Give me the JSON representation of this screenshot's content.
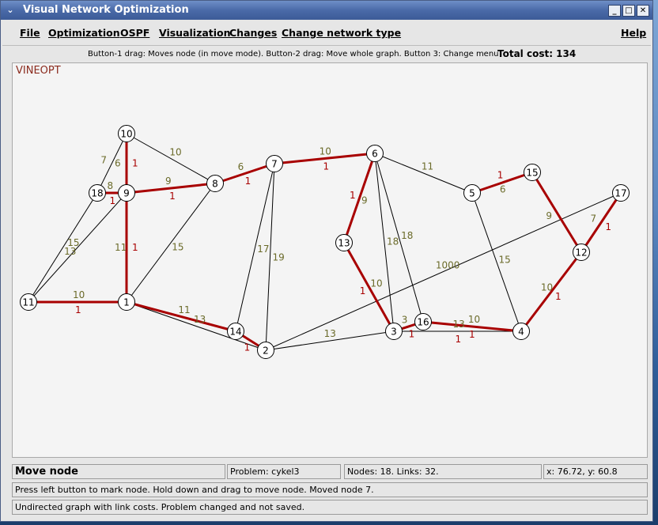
{
  "window": {
    "title": "Visual Network Optimization",
    "buttons": [
      "_",
      "□",
      "✕"
    ]
  },
  "menubar": {
    "items": [
      {
        "label": "File"
      },
      {
        "label": "Optimization"
      },
      {
        "label": "OSPF"
      },
      {
        "label": "Visualization"
      },
      {
        "label": "Changes"
      },
      {
        "label": "Change network type"
      }
    ],
    "help": "Help"
  },
  "infobar": {
    "hint": "Button-1 drag: Moves node (in move mode). Button-2 drag: Move whole graph. Button 3: Change menu",
    "total_cost": "Total cost: 134"
  },
  "canvas": {
    "app_label": "VINEOPT",
    "colors": {
      "thick_edge": "#a80000",
      "cost_text": "#6b6b2a",
      "flow_text": "#a80000"
    },
    "nodes": [
      {
        "id": "1"
      },
      {
        "id": "2"
      },
      {
        "id": "3"
      },
      {
        "id": "4"
      },
      {
        "id": "5"
      },
      {
        "id": "6"
      },
      {
        "id": "7"
      },
      {
        "id": "8"
      },
      {
        "id": "9"
      },
      {
        "id": "10"
      },
      {
        "id": "11"
      },
      {
        "id": "12"
      },
      {
        "id": "13"
      },
      {
        "id": "14"
      },
      {
        "id": "15"
      },
      {
        "id": "16"
      },
      {
        "id": "17"
      },
      {
        "id": "18"
      }
    ],
    "edges": [
      {
        "a": "11",
        "b": "1",
        "cost": "10",
        "flow": "1",
        "thick": true
      },
      {
        "a": "1",
        "b": "9",
        "cost": "11",
        "flow": "1",
        "thick": true
      },
      {
        "a": "9",
        "b": "10",
        "cost": "6",
        "flow": "1",
        "thick": true
      },
      {
        "a": "9",
        "b": "8",
        "cost": "9",
        "flow": "1",
        "thick": true
      },
      {
        "a": "8",
        "b": "7",
        "cost": "6",
        "flow": "1",
        "thick": true
      },
      {
        "a": "7",
        "b": "6",
        "cost": "10",
        "flow": "1",
        "thick": true
      },
      {
        "a": "6",
        "b": "13",
        "cost": "9",
        "flow": "1",
        "thick": true
      },
      {
        "a": "13",
        "b": "3",
        "cost": "10",
        "flow": "1",
        "thick": true
      },
      {
        "a": "3",
        "b": "16",
        "cost": "3",
        "flow": "1",
        "thick": true
      },
      {
        "a": "16",
        "b": "4",
        "cost": "10",
        "flow": "1",
        "thick": true
      },
      {
        "a": "4",
        "b": "12",
        "cost": "10",
        "flow": "1",
        "thick": true
      },
      {
        "a": "12",
        "b": "15",
        "cost": "9",
        "flow": "",
        "thick": true
      },
      {
        "a": "15",
        "b": "5",
        "cost": "6",
        "flow": "1",
        "thick": true
      },
      {
        "a": "12",
        "b": "17",
        "cost": "7",
        "flow": "1",
        "thick": true
      },
      {
        "a": "1",
        "b": "14",
        "cost": "11",
        "flow": "",
        "thick": true
      },
      {
        "a": "14",
        "b": "2",
        "cost": "",
        "flow": "1",
        "thick": true
      },
      {
        "a": "18",
        "b": "9",
        "cost": "8",
        "flow": "1",
        "thick": true
      },
      {
        "a": "10",
        "b": "8",
        "cost": "10",
        "flow": "",
        "thick": false
      },
      {
        "a": "18",
        "b": "10",
        "cost": "7",
        "flow": "",
        "thick": false
      },
      {
        "a": "18",
        "b": "11",
        "cost": "13",
        "flow": "",
        "thick": false
      },
      {
        "a": "11",
        "b": "9",
        "cost": "15",
        "flow": "",
        "thick": false
      },
      {
        "a": "8",
        "b": "1",
        "cost": "15",
        "flow": "",
        "thick": false
      },
      {
        "a": "7",
        "b": "14",
        "cost": "17",
        "flow": "",
        "thick": false
      },
      {
        "a": "7",
        "b": "2",
        "cost": "19",
        "flow": "",
        "thick": false
      },
      {
        "a": "1",
        "b": "2",
        "cost": "13",
        "flow": "",
        "thick": false
      },
      {
        "a": "2",
        "b": "3",
        "cost": "13",
        "flow": "",
        "thick": false
      },
      {
        "a": "2",
        "b": "17",
        "cost": "1000",
        "flow": "",
        "thick": false
      },
      {
        "a": "6",
        "b": "5",
        "cost": "11",
        "flow": "",
        "thick": false
      },
      {
        "a": "6",
        "b": "3",
        "cost": "18",
        "flow": "",
        "thick": false
      },
      {
        "a": "6",
        "b": "16",
        "cost": "18",
        "flow": "",
        "thick": false
      },
      {
        "a": "5",
        "b": "4",
        "cost": "15",
        "flow": "",
        "thick": false
      },
      {
        "a": "3",
        "b": "4",
        "cost": "13",
        "flow": "1",
        "thick": false
      }
    ]
  },
  "status": {
    "mode": "Move node",
    "problem": "Problem: cykel3",
    "counts": "Nodes: 18. Links: 32.",
    "coords": "x: 76.72, y: 60.8",
    "message": "Press left button to mark node. Hold down and drag to move node. Moved node 7.",
    "graph_state": "Undirected graph with link costs. Problem changed and not saved."
  }
}
